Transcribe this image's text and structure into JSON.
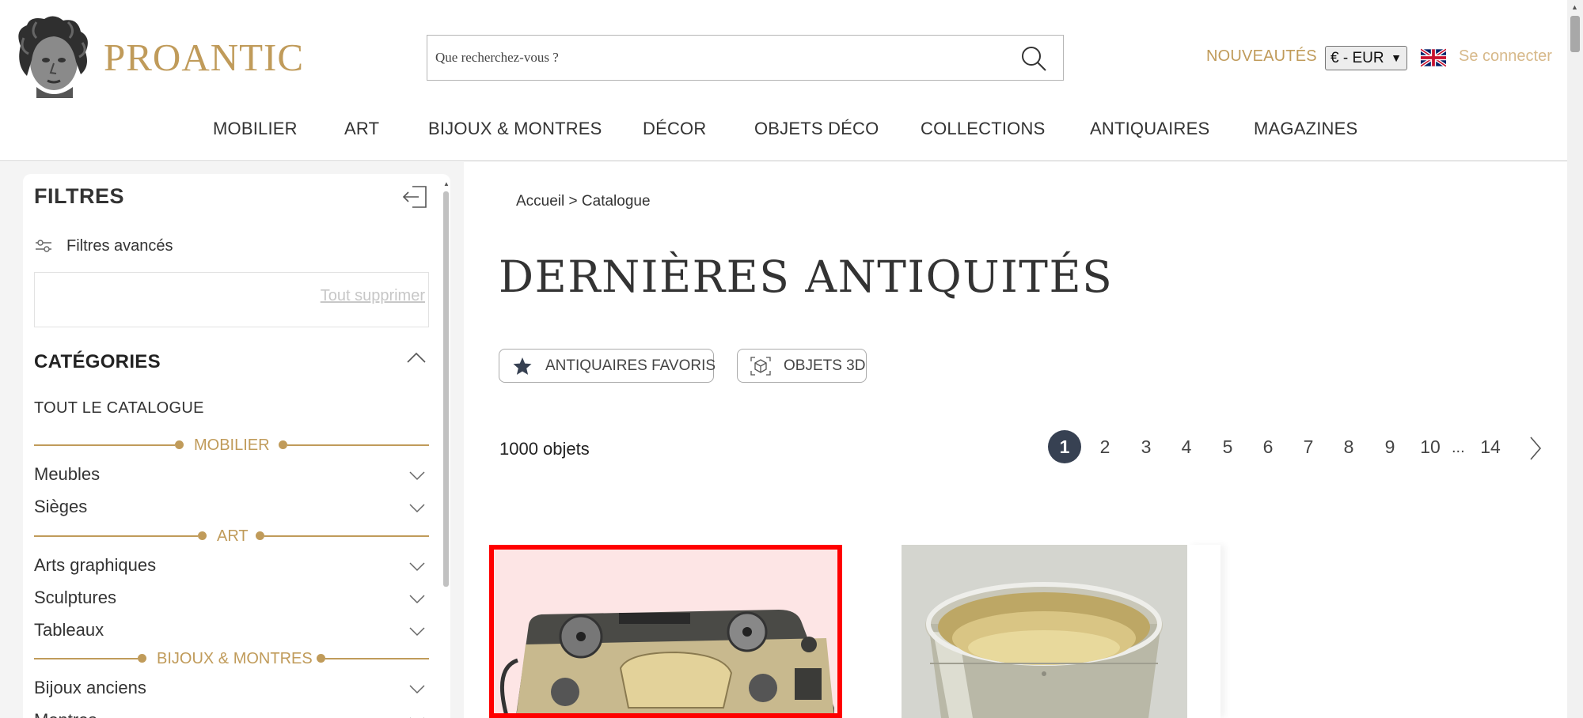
{
  "header": {
    "logo_text": "PROANTIC",
    "search_placeholder": "Que recherchez-vous ?",
    "nouveautes": "NOUVEAUTÉS",
    "currency": "€ - EUR",
    "login": "Se connecter",
    "nav": [
      "MOBILIER",
      "ART",
      "BIJOUX & MONTRES",
      "DÉCOR",
      "OBJETS DÉCO",
      "COLLECTIONS",
      "ANTIQUAIRES",
      "MAGAZINES"
    ]
  },
  "filters": {
    "title": "FILTRES",
    "advanced": "Filtres avancés",
    "clear_all": "Tout supprimer",
    "categories_title": "CATÉGORIES",
    "all_catalog": "TOUT LE CATALOGUE",
    "sections": [
      {
        "label": "MOBILIER",
        "items": [
          "Meubles",
          "Sièges"
        ]
      },
      {
        "label": "ART",
        "items": [
          "Arts graphiques",
          "Sculptures",
          "Tableaux"
        ]
      },
      {
        "label": "BIJOUX & MONTRES",
        "items": [
          "Bijoux anciens",
          "Montres"
        ]
      }
    ]
  },
  "main": {
    "breadcrumb": "Accueil > Catalogue",
    "title": "DERNIÈRES ANTIQUITÉS",
    "chips": [
      "ANTIQUAIRES FAVORIS",
      "OBJETS 3D"
    ],
    "count": "1000 objets",
    "pages": [
      "1",
      "2",
      "3",
      "4",
      "5",
      "6",
      "7",
      "8",
      "9",
      "10"
    ],
    "pages_ellipsis": "...",
    "last_page": "14",
    "current_page": "1"
  },
  "colors": {
    "accent": "#c09b5a",
    "pager_active": "#374152",
    "highlight": "#ff0000"
  }
}
